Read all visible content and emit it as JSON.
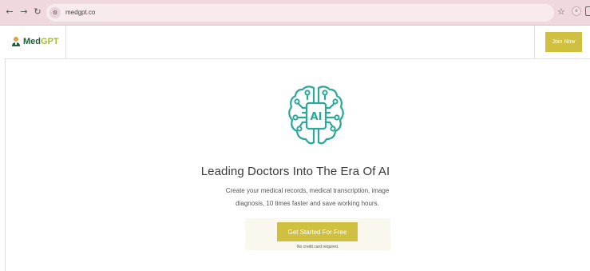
{
  "browser": {
    "back_icon": "arrow-left-icon",
    "forward_icon": "arrow-right-icon",
    "reload_icon": "reload-icon",
    "url": "medgpt.co",
    "bookmark_icon": "star-icon"
  },
  "navbar": {
    "brand_med": "Med",
    "brand_gpt": "GPT",
    "join_label": "Join Now"
  },
  "hero": {
    "icon": "brain-ai-chip-icon",
    "title": "Leading Doctors Into The Era Of AI",
    "subtitle_line1": "Create your medical records, medical transcription, image",
    "subtitle_line2": "diagnosis, 10 times faster and save working hours.",
    "cta_label": "Get Started For Free",
    "cta_note": "No credit card required."
  },
  "colors": {
    "browser_bar": "#efd9df",
    "accent": "#cfc03f",
    "brand_green": "#1f5f3c",
    "icon_teal": "#2aa89a"
  }
}
